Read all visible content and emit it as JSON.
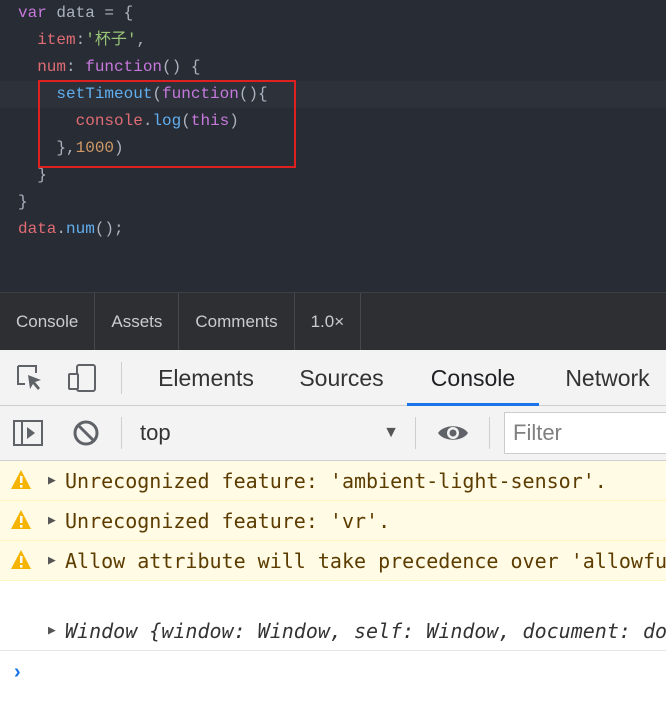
{
  "editor": {
    "lines": [
      [
        {
          "t": "var",
          "c": "kw"
        },
        {
          "t": " data = {",
          "c": "pun"
        }
      ],
      [
        {
          "t": "  ",
          "c": "pun"
        },
        {
          "t": "item",
          "c": "prop"
        },
        {
          "t": ":",
          "c": "pun"
        },
        {
          "t": "'杯子'",
          "c": "str"
        },
        {
          "t": ",",
          "c": "pun"
        }
      ],
      [
        {
          "t": "  ",
          "c": "pun"
        },
        {
          "t": "num",
          "c": "prop"
        },
        {
          "t": ": ",
          "c": "pun"
        },
        {
          "t": "function",
          "c": "kw"
        },
        {
          "t": "() {",
          "c": "pun"
        }
      ],
      [
        {
          "t": "    ",
          "c": "pun"
        },
        {
          "t": "setTimeout",
          "c": "fn"
        },
        {
          "t": "(",
          "c": "pun"
        },
        {
          "t": "function",
          "c": "kw"
        },
        {
          "t": "(){",
          "c": "pun"
        }
      ],
      [
        {
          "t": "      ",
          "c": "pun"
        },
        {
          "t": "console",
          "c": "prop"
        },
        {
          "t": ".",
          "c": "pun"
        },
        {
          "t": "log",
          "c": "fn"
        },
        {
          "t": "(",
          "c": "pun"
        },
        {
          "t": "this",
          "c": "kw"
        },
        {
          "t": ")",
          "c": "pun"
        }
      ],
      [
        {
          "t": "    },",
          "c": "pun"
        },
        {
          "t": "1000",
          "c": "num"
        },
        {
          "t": ")",
          "c": "pun"
        }
      ],
      [
        {
          "t": "  }",
          "c": "pun"
        }
      ],
      [
        {
          "t": "}",
          "c": "pun"
        }
      ],
      [
        {
          "t": "data",
          "c": "prop"
        },
        {
          "t": ".",
          "c": "pun"
        },
        {
          "t": "num",
          "c": "fn"
        },
        {
          "t": "();",
          "c": "pun"
        }
      ]
    ],
    "active_line": 3
  },
  "player_bar": {
    "items": [
      "Console",
      "Assets",
      "Comments",
      "1.0×"
    ]
  },
  "devtools": {
    "tabs": [
      "Elements",
      "Sources",
      "Console",
      "Network"
    ],
    "selected_tab": "Console",
    "icons": {
      "inspect": "inspect-element-icon",
      "device": "device-toolbar-icon",
      "sidebar": "show-sidebar-icon",
      "clear": "clear-console-icon",
      "eye": "live-expression-eye-icon"
    },
    "context": "top",
    "filter_placeholder": "Filter"
  },
  "console": {
    "messages": [
      {
        "level": "warning",
        "text": "Unrecognized feature: 'ambient-light-sensor'."
      },
      {
        "level": "warning",
        "text": "Unrecognized feature: 'vr'."
      },
      {
        "level": "warning",
        "text": "Allow attribute will take precedence over 'allowfullscreen'."
      },
      {
        "level": "log",
        "text": "Window {window: Window, self: Window, document: document, name: \"\", location: Location, …}"
      }
    ]
  },
  "colors": {
    "editor_bg": "#282c34",
    "highlight_box": "#e02020",
    "selected_tab_underline": "#1a73e8",
    "warning_bg": "#fffbe5"
  }
}
